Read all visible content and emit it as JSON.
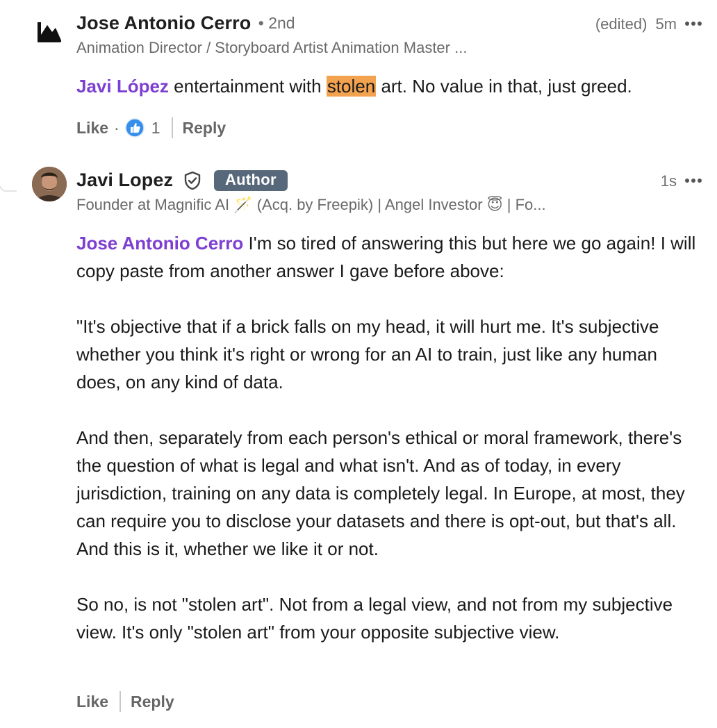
{
  "comments": [
    {
      "author_name": "Jose Antonio Cerro",
      "degree": "• 2nd",
      "headline": "Animation Director / Storyboard Artist Animation Master ...",
      "edited_label": "(edited)",
      "time": "5m",
      "mention": "Javi López",
      "text_before_highlight": " entertainment with ",
      "highlight": "stolen",
      "text_after_highlight": " art. No value in that, just greed.",
      "actions": {
        "like_label": "Like",
        "separator": "·",
        "reaction_count": "1",
        "reply_label": "Reply"
      }
    },
    {
      "author_name": "Javi Lopez",
      "badge": "Author",
      "headline": "Founder at Magnific AI 🪄 (Acq. by Freepik) | Angel Investor 😇 | Fo...",
      "time": "1s",
      "mention": "Jose Antonio Cerro",
      "paragraphs": [
        " I'm so tired of answering this but here we go again! I will copy paste from another answer I gave before above:",
        "\"It's objective that if a brick falls on my head, it will hurt me. It's subjective whether you think it's right or wrong for an AI to train, just like any human does, on any kind of data.",
        "And then, separately from each person's ethical or moral framework, there's the question of what is legal and what isn't. And as of today, in every jurisdiction, training on any data is completely legal. In Europe, at most, they can require you to disclose your datasets and there is opt-out, but that's all. And this is it, whether we like it or not.",
        "So no, is not \"stolen art\". Not from a legal view, and not from my subjective view. It's only \"stolen art\" from your opposite subjective view."
      ],
      "actions": {
        "like_label": "Like",
        "reply_label": "Reply"
      }
    }
  ],
  "colors": {
    "mention": "#7d3fd1",
    "highlight": "#f3a24f",
    "author_badge_bg": "#56687a",
    "like_reaction": "#378fe9"
  },
  "icons": {
    "company_logo": "company-logo-icon",
    "verified": "verified-shield-icon",
    "more": "more-options-icon",
    "like_reaction": "like-reaction-icon"
  }
}
